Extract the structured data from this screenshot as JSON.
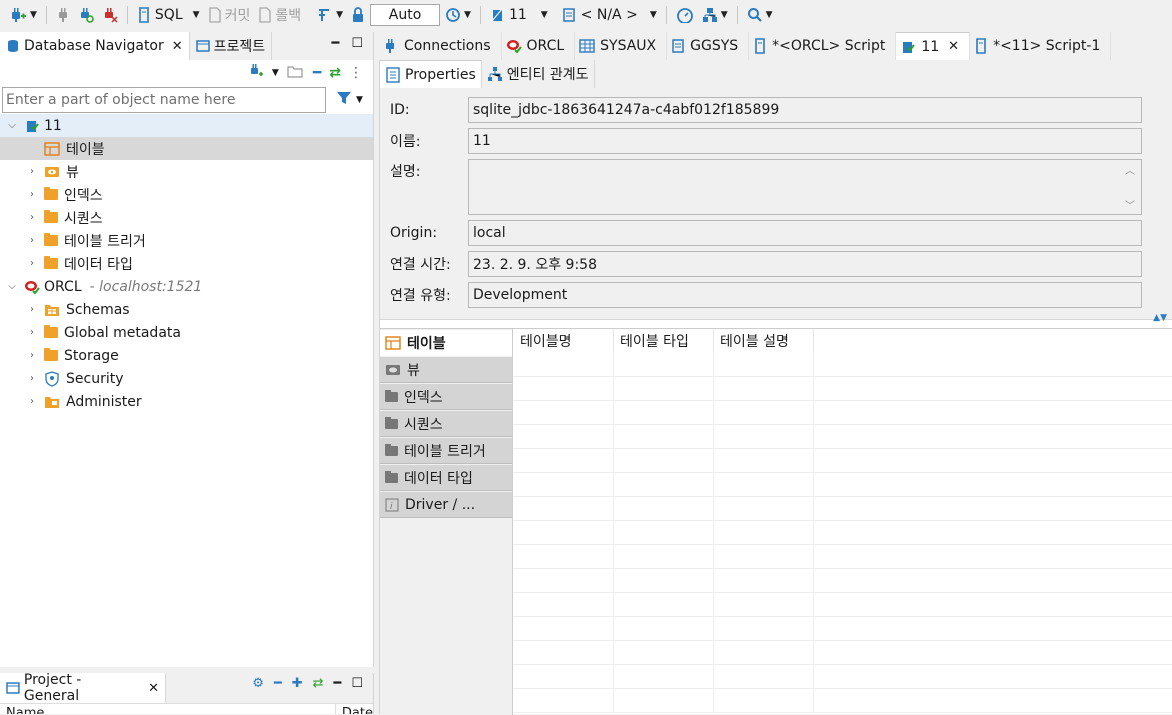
{
  "toolbar": {
    "sql_label": "SQL",
    "commit_label": "커밋",
    "rollback_label": "롤백",
    "transaction_mode": "Auto",
    "active_datasource": "11",
    "active_schema": "< N/A >"
  },
  "navigator": {
    "tab_database_navigator": "Database Navigator",
    "tab_project": "프로젝트",
    "filter_placeholder": "Enter a part of object name here",
    "tree": [
      {
        "label": "11",
        "sub": ""
      },
      {
        "label": "테이블",
        "sub": ""
      },
      {
        "label": "뷰",
        "sub": ""
      },
      {
        "label": "인덱스",
        "sub": ""
      },
      {
        "label": "시퀀스",
        "sub": ""
      },
      {
        "label": "테이블 트리거",
        "sub": ""
      },
      {
        "label": "데이터 타입",
        "sub": ""
      },
      {
        "label": "ORCL",
        "sub": "- localhost:1521"
      },
      {
        "label": "Schemas",
        "sub": ""
      },
      {
        "label": "Global metadata",
        "sub": ""
      },
      {
        "label": "Storage",
        "sub": ""
      },
      {
        "label": "Security",
        "sub": ""
      },
      {
        "label": "Administer",
        "sub": ""
      }
    ]
  },
  "project_panel": {
    "tab_label": "Project - General",
    "col_name": "Name",
    "col_date": "Date"
  },
  "editor_tabs": [
    {
      "label": "Connections"
    },
    {
      "label": "ORCL"
    },
    {
      "label": "SYSAUX"
    },
    {
      "label": "GGSYS"
    },
    {
      "label": "*<ORCL> Script"
    },
    {
      "label": "11"
    },
    {
      "label": "*<11> Script-1"
    }
  ],
  "sub_tabs": {
    "properties": "Properties",
    "er": "엔티티 관계도"
  },
  "properties": {
    "id_label": "ID:",
    "id_value": "sqlite_jdbc-1863641247a-c4abf012f185899",
    "name_label": "이름:",
    "name_value": "11",
    "desc_label": "설명:",
    "desc_value": "",
    "origin_label": "Origin:",
    "origin_value": "local",
    "conn_time_label": "연결 시간:",
    "conn_time_value": "23. 2. 9. 오후 9:58",
    "conn_type_label": "연결 유형:",
    "conn_type_value": "Development"
  },
  "side_tabs": [
    {
      "label": "테이블"
    },
    {
      "label": "뷰"
    },
    {
      "label": "인덱스"
    },
    {
      "label": "시퀀스"
    },
    {
      "label": "테이블 트리거"
    },
    {
      "label": "데이터 타입"
    },
    {
      "label": "Driver / ..."
    }
  ],
  "grid_columns": [
    "테이블명",
    "테이블 타입",
    "테이블 설명"
  ],
  "colors": {
    "accent_blue": "#1f6fc0",
    "oracle_red": "#d02020",
    "folder_orange": "#f0a12a",
    "selection_gray": "#d8d8d8"
  }
}
